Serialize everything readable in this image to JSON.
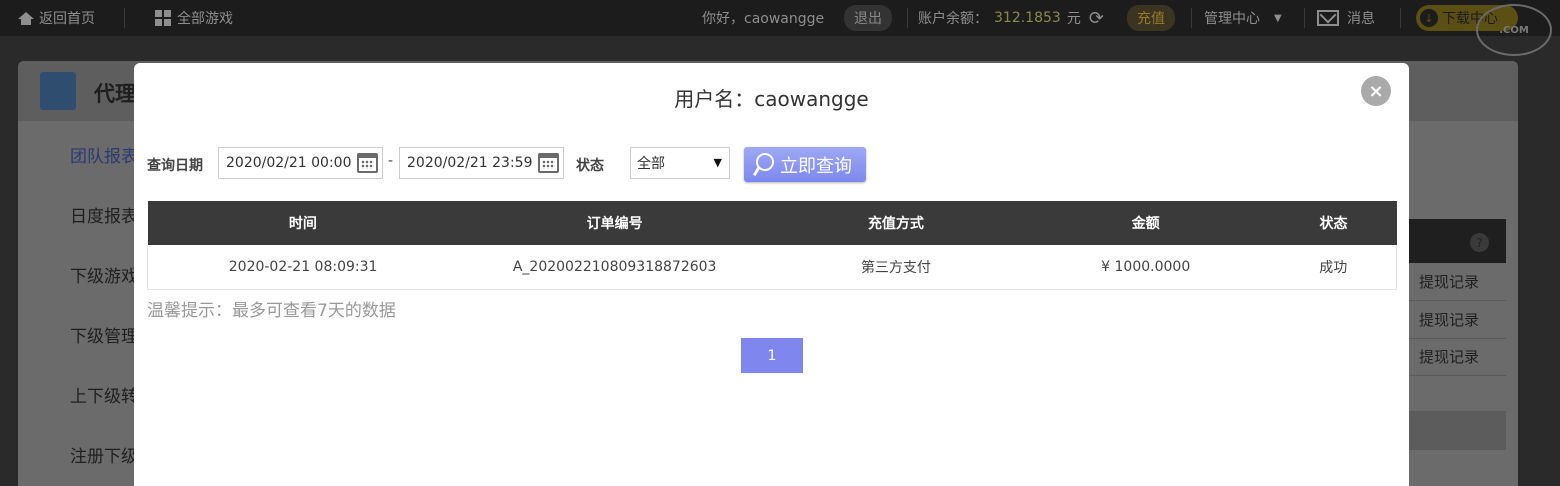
{
  "topbar": {
    "home_label": "返回首页",
    "all_games_label": "全部游戏",
    "greeting": "你好，caowangge",
    "logout_label": "退出",
    "balance_label": "账户余额：",
    "balance_value": "312.1853",
    "balance_unit": "元",
    "recharge_label": "充值",
    "manage_label": "管理中心",
    "messages_label": "消息",
    "download_label": "下载中心"
  },
  "background_page": {
    "title": "代理",
    "side_items": [
      "团队报表",
      "日度报表",
      "下级游戏",
      "下级管理",
      "上下级转",
      "注册下级"
    ],
    "right_rows": [
      "提现记录",
      "提现记录",
      "提现记录"
    ],
    "help_icon_text": "?"
  },
  "modal": {
    "title": "用户名：caowangge",
    "close_label": "×",
    "query_date_label": "查询日期",
    "start_date": "2020/02/21 00:00",
    "date_separator": "-",
    "end_date": "2020/02/21 23:59",
    "status_label": "状态",
    "status_selected": "全部",
    "query_button": "立即查询",
    "table": {
      "headers": [
        "时间",
        "订单编号",
        "充值方式",
        "金额",
        "状态"
      ],
      "rows": [
        [
          "2020-02-21 08:09:31",
          "A_20200221080931887260​3",
          "第三方支付",
          "¥ 1000.0000",
          "成功"
        ]
      ]
    },
    "tip": "温馨提示：最多可查看7天的数据",
    "pagination": [
      "1"
    ]
  }
}
